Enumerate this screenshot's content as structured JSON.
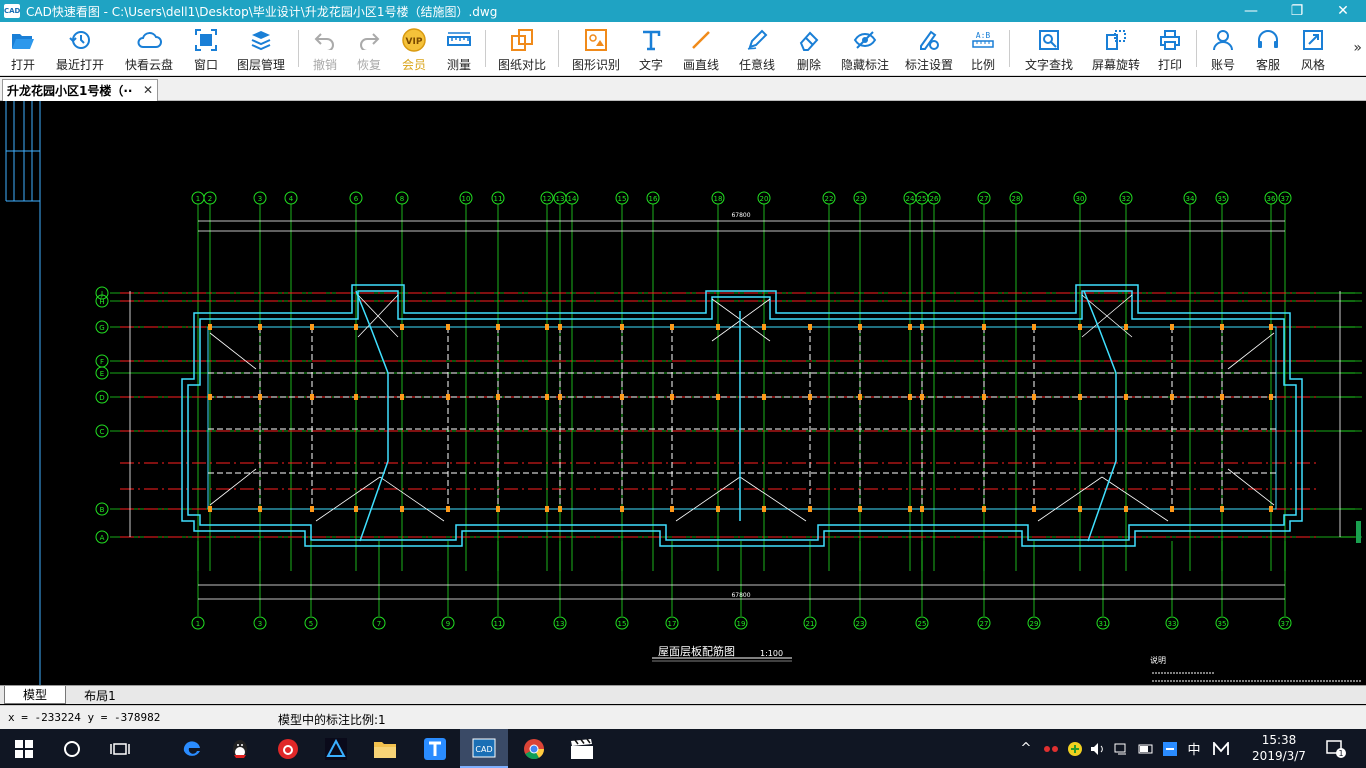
{
  "window": {
    "app_icon": "CAD",
    "title": "CAD快速看图 - C:\\Users\\dell1\\Desktop\\毕业设计\\升龙花园小区1号楼（结施图）.dwg",
    "minimize_icon": "—",
    "restore_icon": "❐",
    "close_icon": "✕"
  },
  "toolbar": {
    "open": "打开",
    "recent": "最近打开",
    "cloud": "快看云盘",
    "window": "窗口",
    "layers": "图层管理",
    "undo": "撤销",
    "redo": "恢复",
    "vip": "会员",
    "measure": "测量",
    "compare": "图纸对比",
    "shape_recog": "图形识别",
    "text": "文字",
    "line": "画直线",
    "freeline": "任意线",
    "delete": "删除",
    "hide_annot": "隐藏标注",
    "annot_settings": "标注设置",
    "scale": "比例",
    "text_search": "文字查找",
    "rotate": "屏幕旋转",
    "print": "打印",
    "account": "账号",
    "service": "客服",
    "style": "风格",
    "more": "»",
    "vip_badge": "VIP"
  },
  "document": {
    "tab_label": "升龙花园小区1号楼（··",
    "tab_close": "✕"
  },
  "drawing": {
    "plan_title": "屋面层板配筋图",
    "plan_scale": "1:100",
    "notes_title": "说明",
    "top_axes": [
      "1",
      "2",
      "3",
      "4",
      "6",
      "8",
      "10",
      "11",
      "12",
      "13",
      "14",
      "15",
      "16",
      "18",
      "20",
      "22",
      "23",
      "24",
      "25",
      "26",
      "27",
      "28",
      "30",
      "32",
      "34",
      "35",
      "36",
      "37"
    ],
    "bottom_axes": [
      "1",
      "3",
      "5",
      "7",
      "9",
      "11",
      "13",
      "15",
      "17",
      "19",
      "21",
      "23",
      "25",
      "27",
      "29",
      "31",
      "33",
      "35",
      "37"
    ],
    "row_axes": [
      "J",
      "H",
      "G",
      "F",
      "E",
      "D",
      "C",
      "B",
      "A"
    ],
    "top_total": "67800",
    "bottom_total": "67800",
    "colors": {
      "axis_green": "#22e022",
      "wall_cyan": "#40e0ff",
      "red_line": "#ff2020",
      "beam_white": "#ffffff",
      "column_orange": "#ff9a1a"
    }
  },
  "layout_tabs": [
    "模型",
    "布局1"
  ],
  "status": {
    "coords": "x = -233224  y = -378982",
    "scale_text": "模型中的标注比例:1"
  },
  "taskbar": {
    "ime": "中",
    "time": "15:38",
    "date": "2019/3/7",
    "notify_count": "1"
  }
}
